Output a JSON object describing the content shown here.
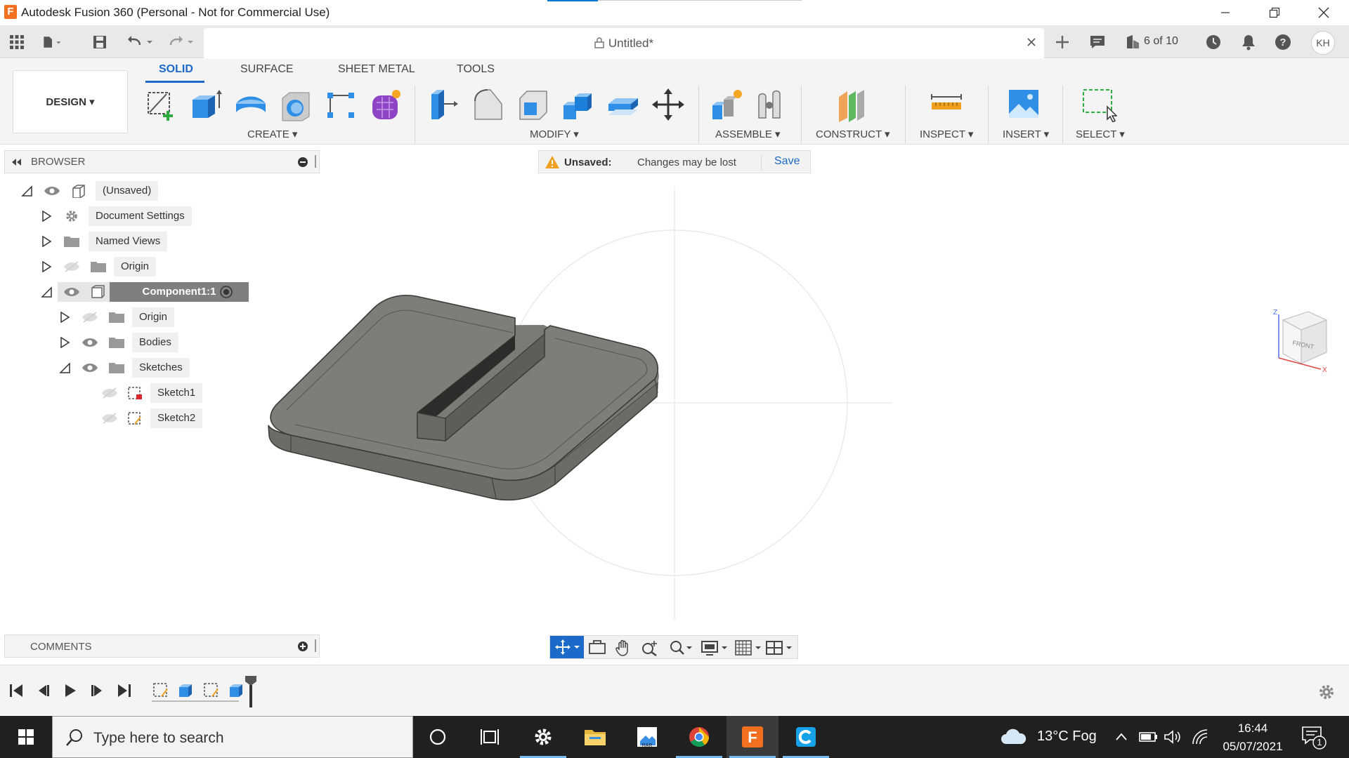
{
  "window": {
    "title": "Autodesk Fusion 360 (Personal - Not for Commercial Use)",
    "logo_letter": "F"
  },
  "tabbar": {
    "document_title": "Untitled*",
    "job_status": "6 of 10",
    "user_initials": "KH"
  },
  "ribbon": {
    "workspace": "DESIGN ▾",
    "tabs": [
      {
        "label": "SOLID",
        "active": true
      },
      {
        "label": "SURFACE",
        "active": false
      },
      {
        "label": "SHEET METAL",
        "active": false
      },
      {
        "label": "TOOLS",
        "active": false
      }
    ],
    "groups": {
      "create": "CREATE ▾",
      "modify": "MODIFY ▾",
      "assemble": "ASSEMBLE ▾",
      "construct": "CONSTRUCT ▾",
      "inspect": "INSPECT ▾",
      "insert": "INSERT ▾",
      "select": "SELECT ▾"
    }
  },
  "browser": {
    "title": "BROWSER",
    "items": [
      {
        "label": "(Unsaved)"
      },
      {
        "label": "Document Settings"
      },
      {
        "label": "Named Views"
      },
      {
        "label": "Origin"
      },
      {
        "label": "Component1:1"
      },
      {
        "label": "Origin"
      },
      {
        "label": "Bodies"
      },
      {
        "label": "Sketches"
      },
      {
        "label": "Sketch1"
      },
      {
        "label": "Sketch2"
      }
    ]
  },
  "banner": {
    "title": "Unsaved:",
    "message": "Changes may be lost",
    "save_label": "Save"
  },
  "viewcube": {
    "face_label": "FRONT",
    "axis_z": "Z",
    "axis_x": "X"
  },
  "comments": {
    "title": "COMMENTS"
  },
  "taskbar": {
    "search_placeholder": "Type here to search",
    "weather": "13°C  Fog",
    "time": "16:44",
    "date": "05/07/2021",
    "notification_count": "1"
  },
  "colors": {
    "accent_blue": "#1b6ac9",
    "body_fill": "#7b7a74",
    "taskbar": "#202020"
  }
}
